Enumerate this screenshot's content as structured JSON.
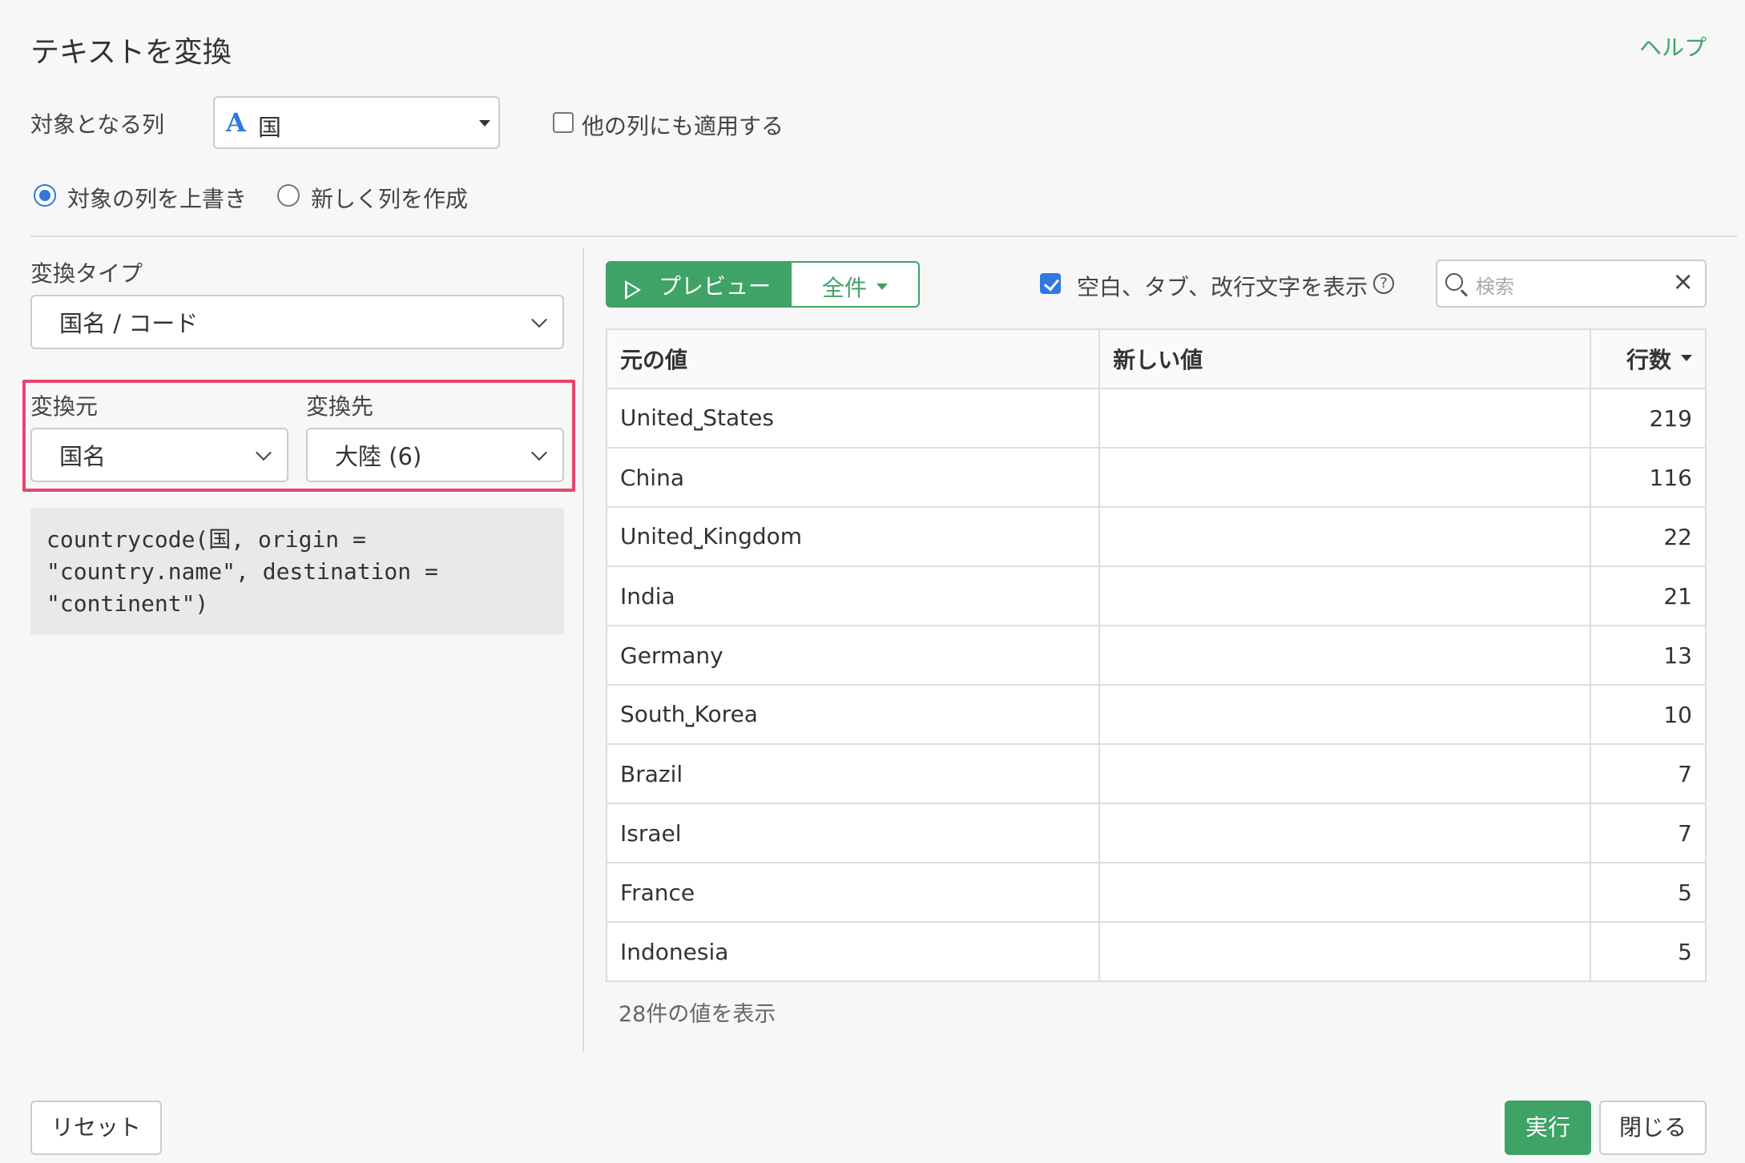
{
  "dialog": {
    "title": "テキストを変換",
    "help_label": "ヘルプ"
  },
  "target": {
    "label": "対象となる列",
    "column_type_icon": "A",
    "column_value": "国",
    "apply_others_label": "他の列にも適用する",
    "apply_others_checked": false
  },
  "output_mode": {
    "overwrite_label": "対象の列を上書き",
    "new_column_label": "新しく列を作成",
    "selected": "overwrite"
  },
  "conversion": {
    "type_label": "変換タイプ",
    "type_value": "国名 / コード",
    "from_label": "変換元",
    "from_value": "国名",
    "to_label": "変換先",
    "to_value": "大陸 (6)",
    "code": "countrycode(国, origin =\n\"country.name\", destination =\n\"continent\")"
  },
  "preview": {
    "preview_button": "プレビュー",
    "all_button": "全件",
    "show_whitespace_label": "空白、タブ、改行文字を表示",
    "show_whitespace_checked": true,
    "search_placeholder": "検索",
    "columns": [
      "元の値",
      "新しい値",
      "行数"
    ],
    "rows": [
      {
        "original": "United⎵States",
        "new": "",
        "count": "219"
      },
      {
        "original": "China",
        "new": "",
        "count": "116"
      },
      {
        "original": "United⎵Kingdom",
        "new": "",
        "count": "22"
      },
      {
        "original": "India",
        "new": "",
        "count": "21"
      },
      {
        "original": "Germany",
        "new": "",
        "count": "13"
      },
      {
        "original": "South⎵Korea",
        "new": "",
        "count": "10"
      },
      {
        "original": "Brazil",
        "new": "",
        "count": "7"
      },
      {
        "original": "Israel",
        "new": "",
        "count": "7"
      },
      {
        "original": "France",
        "new": "",
        "count": "5"
      },
      {
        "original": "Indonesia",
        "new": "",
        "count": "5"
      }
    ],
    "count_summary": "28件の値を表示"
  },
  "footer": {
    "reset_label": "リセット",
    "run_label": "実行",
    "close_label": "閉じる"
  },
  "colors": {
    "accent_green": "#3fa266",
    "highlight_pink": "#e8456e",
    "checkbox_blue": "#2f78e0"
  }
}
